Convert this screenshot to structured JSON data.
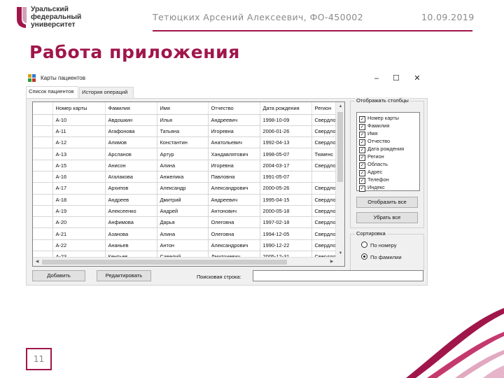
{
  "slide": {
    "logo_lines": [
      "Уральский",
      "федеральный",
      "университет"
    ],
    "author": "Тетюцких Арсений Алексеевич, ФО-450002",
    "date": "10.09.2019",
    "title": "Работа приложения",
    "page_number": "11",
    "accent_color": "#a0164a"
  },
  "window": {
    "title": "Карты пациентов",
    "controls": {
      "minimize": "–",
      "maximize": "☐",
      "close": "✕"
    },
    "tabs": [
      {
        "label": "Список пациентов",
        "active": true
      },
      {
        "label": "История операций",
        "active": false
      }
    ]
  },
  "grid": {
    "columns": [
      "Номер карты",
      "Фамилия",
      "Имя",
      "Отчество",
      "Дата рождения",
      "Регион"
    ],
    "rows": [
      [
        "А-10",
        "Авдошкин",
        "Илья",
        "Андреевич",
        "1998-10-09",
        "Свердло"
      ],
      [
        "А-11",
        "Агафонова",
        "Татьяна",
        "Игоревна",
        "2006-01-26",
        "Свердло"
      ],
      [
        "А-12",
        "Алимов",
        "Константин",
        "Анатольевич",
        "1992-04-13",
        "Свердло"
      ],
      [
        "А-13",
        "Арсланов",
        "Артур",
        "Хандавлятович",
        "1998-05-07",
        "Тюменс"
      ],
      [
        "А-15",
        "Анисон",
        "Алина",
        "Игоревна",
        "2004-03-17",
        "Свердло"
      ],
      [
        "А-16",
        "Агалакова",
        "Анжелика",
        "Павловна",
        "1991-05-07",
        ""
      ],
      [
        "А-17",
        "Архипов",
        "Александр",
        "Александрович",
        "2000-05-26",
        "Свердло"
      ],
      [
        "А-18",
        "Андреев",
        "Дмитрий",
        "Андреевич",
        "1995-04-15",
        "Свердло"
      ],
      [
        "А-19",
        "Алексеенко",
        "Андрей",
        "Антонович",
        "2000-05-18",
        "Свердло"
      ],
      [
        "А-20",
        "Анфимова",
        "Дарья",
        "Олеговна",
        "1997-02-18",
        "Свердло"
      ],
      [
        "А-21",
        "Азанова",
        "Алина",
        "Олеговна",
        "1994-12-05",
        "Свердло"
      ],
      [
        "А-22",
        "Ананьев",
        "Антон",
        "Александрович",
        "1990-12-22",
        "Свердло"
      ],
      [
        "А-23",
        "Кентьев",
        "Савелий",
        "Дмитриевич",
        "2005-12-31",
        "Свердло"
      ]
    ]
  },
  "columns_panel": {
    "legend": "Отображать столбцы",
    "items": [
      {
        "label": "Номер карты",
        "checked": true
      },
      {
        "label": "Фамилия",
        "checked": true
      },
      {
        "label": "Имя",
        "checked": true
      },
      {
        "label": "Отчество",
        "checked": true
      },
      {
        "label": "Дата рождения",
        "checked": true
      },
      {
        "label": "Регион",
        "checked": true
      },
      {
        "label": "Область",
        "checked": true
      },
      {
        "label": "Адрес",
        "checked": true
      },
      {
        "label": "Телефон",
        "checked": true
      },
      {
        "label": "Индекс",
        "checked": true
      }
    ],
    "show_all_label": "Отобразить все",
    "hide_all_label": "Убрать все"
  },
  "sort_panel": {
    "legend": "Сортировка",
    "options": [
      {
        "label": "По номеру",
        "selected": false
      },
      {
        "label": "По фамилии",
        "selected": true
      }
    ]
  },
  "bottom": {
    "add_label": "Добавить",
    "edit_label": "Редактировать",
    "search_label": "Поисковая строка:",
    "search_value": ""
  }
}
